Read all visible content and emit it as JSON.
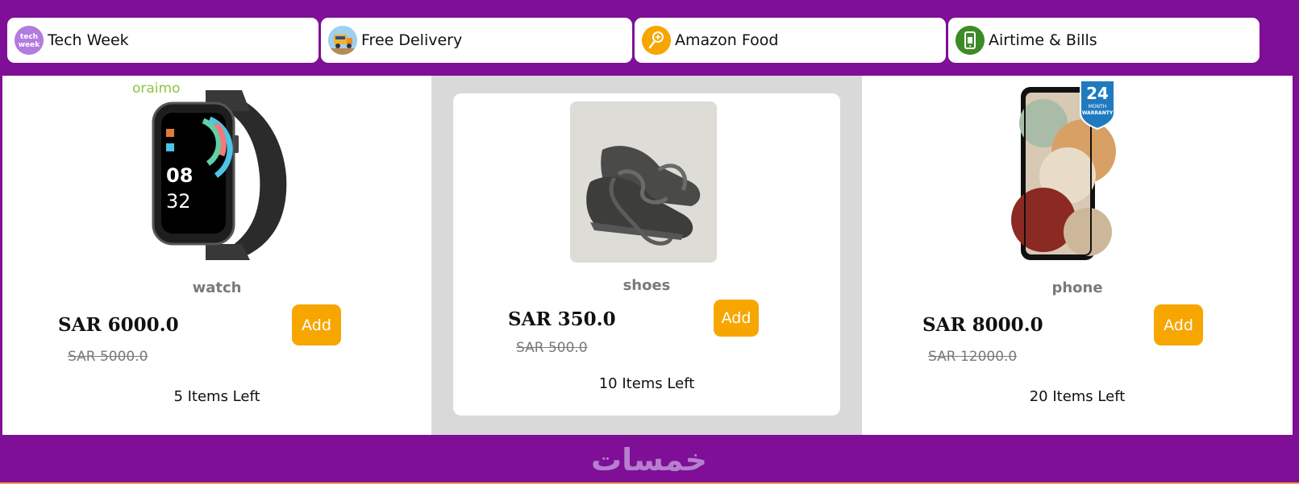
{
  "categories": [
    {
      "label": "Tech Week",
      "icon": "tech-week-icon",
      "icon_text": "tech week"
    },
    {
      "label": "Free Delivery",
      "icon": "delivery-truck-icon"
    },
    {
      "label": "Amazon Food",
      "icon": "food-icon"
    },
    {
      "label": "Airtime & Bills",
      "icon": "phone-bill-icon"
    }
  ],
  "products": [
    {
      "name": "watch",
      "image": "smartwatch-image",
      "brand_text": "oraimo",
      "price": "SAR 6000.0",
      "old_price": "SAR 5000.0",
      "add_label": "Add",
      "stock": "5 Items Left",
      "watch_time_hour": "08",
      "watch_time_min": "32"
    },
    {
      "name": "shoes",
      "image": "sneakers-image",
      "price": "SAR 350.0",
      "old_price": "SAR 500.0",
      "add_label": "Add",
      "stock": "10 Items Left"
    },
    {
      "name": "phone",
      "image": "smartphone-image",
      "price": "SAR 8000.0",
      "old_price": "SAR 12000.0",
      "add_label": "Add",
      "stock": "20 Items Left",
      "badge_number": "24",
      "badge_line1": "MONTH",
      "badge_line2": "WARRANTY"
    }
  ],
  "footer": {
    "logo_text": "خمسات"
  },
  "colors": {
    "background": "#7f0f96",
    "accent": "#f7a600",
    "logo": "#b57fcf"
  }
}
